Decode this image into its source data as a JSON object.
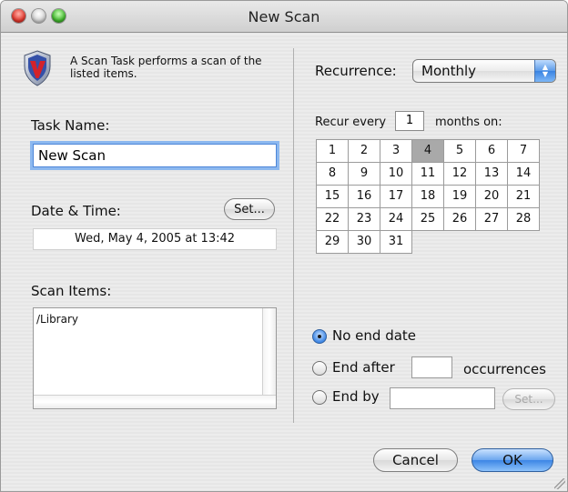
{
  "window": {
    "title": "New Scan"
  },
  "intro": {
    "text": "A Scan Task performs a scan of the listed items."
  },
  "task": {
    "label": "Task Name:",
    "value": "New Scan"
  },
  "datetime": {
    "label": "Date & Time:",
    "set_label": "Set...",
    "value": "Wed, May 4, 2005 at 13:42"
  },
  "scan_items": {
    "label": "Scan Items:",
    "items": [
      "/Library"
    ]
  },
  "recurrence": {
    "label": "Recurrence:",
    "selected": "Monthly",
    "recur_prefix": "Recur every",
    "interval": "1",
    "recur_suffix": "months on:",
    "days": [
      "1",
      "2",
      "3",
      "4",
      "5",
      "6",
      "7",
      "8",
      "9",
      "10",
      "11",
      "12",
      "13",
      "14",
      "15",
      "16",
      "17",
      "18",
      "19",
      "20",
      "21",
      "22",
      "23",
      "24",
      "25",
      "26",
      "27",
      "28",
      "29",
      "30",
      "31"
    ],
    "selected_day": "4"
  },
  "end": {
    "no_end_label": "No end date",
    "after_label": "End after",
    "occurrences_label": "occurrences",
    "by_label": "End by",
    "set_label": "Set...",
    "selected": "no_end"
  },
  "buttons": {
    "cancel": "Cancel",
    "ok": "OK"
  },
  "colors": {
    "accent": "#3d86e5",
    "selected_day": "#a9a9a9"
  }
}
